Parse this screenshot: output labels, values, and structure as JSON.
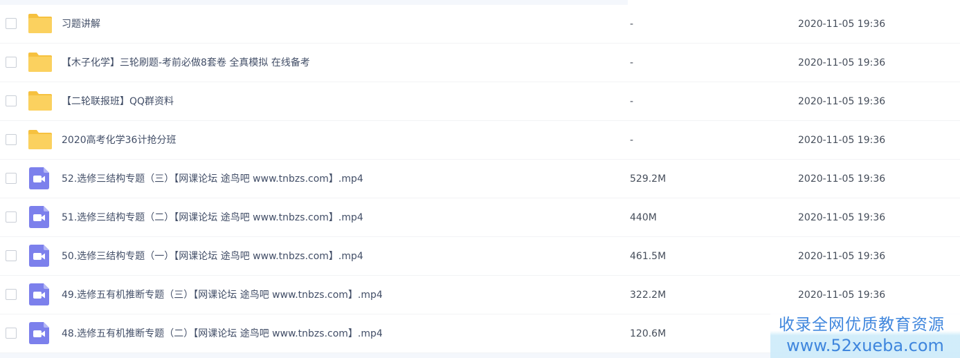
{
  "colors": {
    "folder": "#fbd15f",
    "folder_tab": "#f6c13f",
    "video": "#7c80ec",
    "video_fold": "#b3b6f5",
    "text": "#424e67",
    "watermark_text": "#3f86dd",
    "watermark_bg": "#cfecfa"
  },
  "files": [
    {
      "icon": "folder-icon",
      "name": "习题讲解",
      "size": "-",
      "date": "2020-11-05 19:36"
    },
    {
      "icon": "folder-icon",
      "name": "【木子化学】三轮刷题-考前必做8套卷 全真模拟 在线备考",
      "size": "-",
      "date": "2020-11-05 19:36"
    },
    {
      "icon": "folder-icon",
      "name": "【二轮联报班】QQ群资料",
      "size": "-",
      "date": "2020-11-05 19:36"
    },
    {
      "icon": "folder-icon",
      "name": "2020高考化学36计抢分班",
      "size": "-",
      "date": "2020-11-05 19:36"
    },
    {
      "icon": "video-icon",
      "name": "52.选修三结构专题（三）【网课论坛 途鸟吧 www.tnbzs.com】.mp4",
      "size": "529.2M",
      "date": "2020-11-05 19:36"
    },
    {
      "icon": "video-icon",
      "name": "51.选修三结构专题（二）【网课论坛 途鸟吧 www.tnbzs.com】.mp4",
      "size": "440M",
      "date": "2020-11-05 19:36"
    },
    {
      "icon": "video-icon",
      "name": "50.选修三结构专题（一）【网课论坛 途鸟吧 www.tnbzs.com】.mp4",
      "size": "461.5M",
      "date": "2020-11-05 19:36"
    },
    {
      "icon": "video-icon",
      "name": "49.选修五有机推断专题（三）【网课论坛 途鸟吧 www.tnbzs.com】.mp4",
      "size": "322.2M",
      "date": "2020-11-05 19:36"
    },
    {
      "icon": "video-icon",
      "name": "48.选修五有机推断专题（二）【网课论坛 途鸟吧 www.tnbzs.com】.mp4",
      "size": "120.6M",
      "date": ""
    }
  ],
  "watermark": {
    "line1": "收录全网优质教育资源",
    "line2": "www.52xueba.com"
  }
}
